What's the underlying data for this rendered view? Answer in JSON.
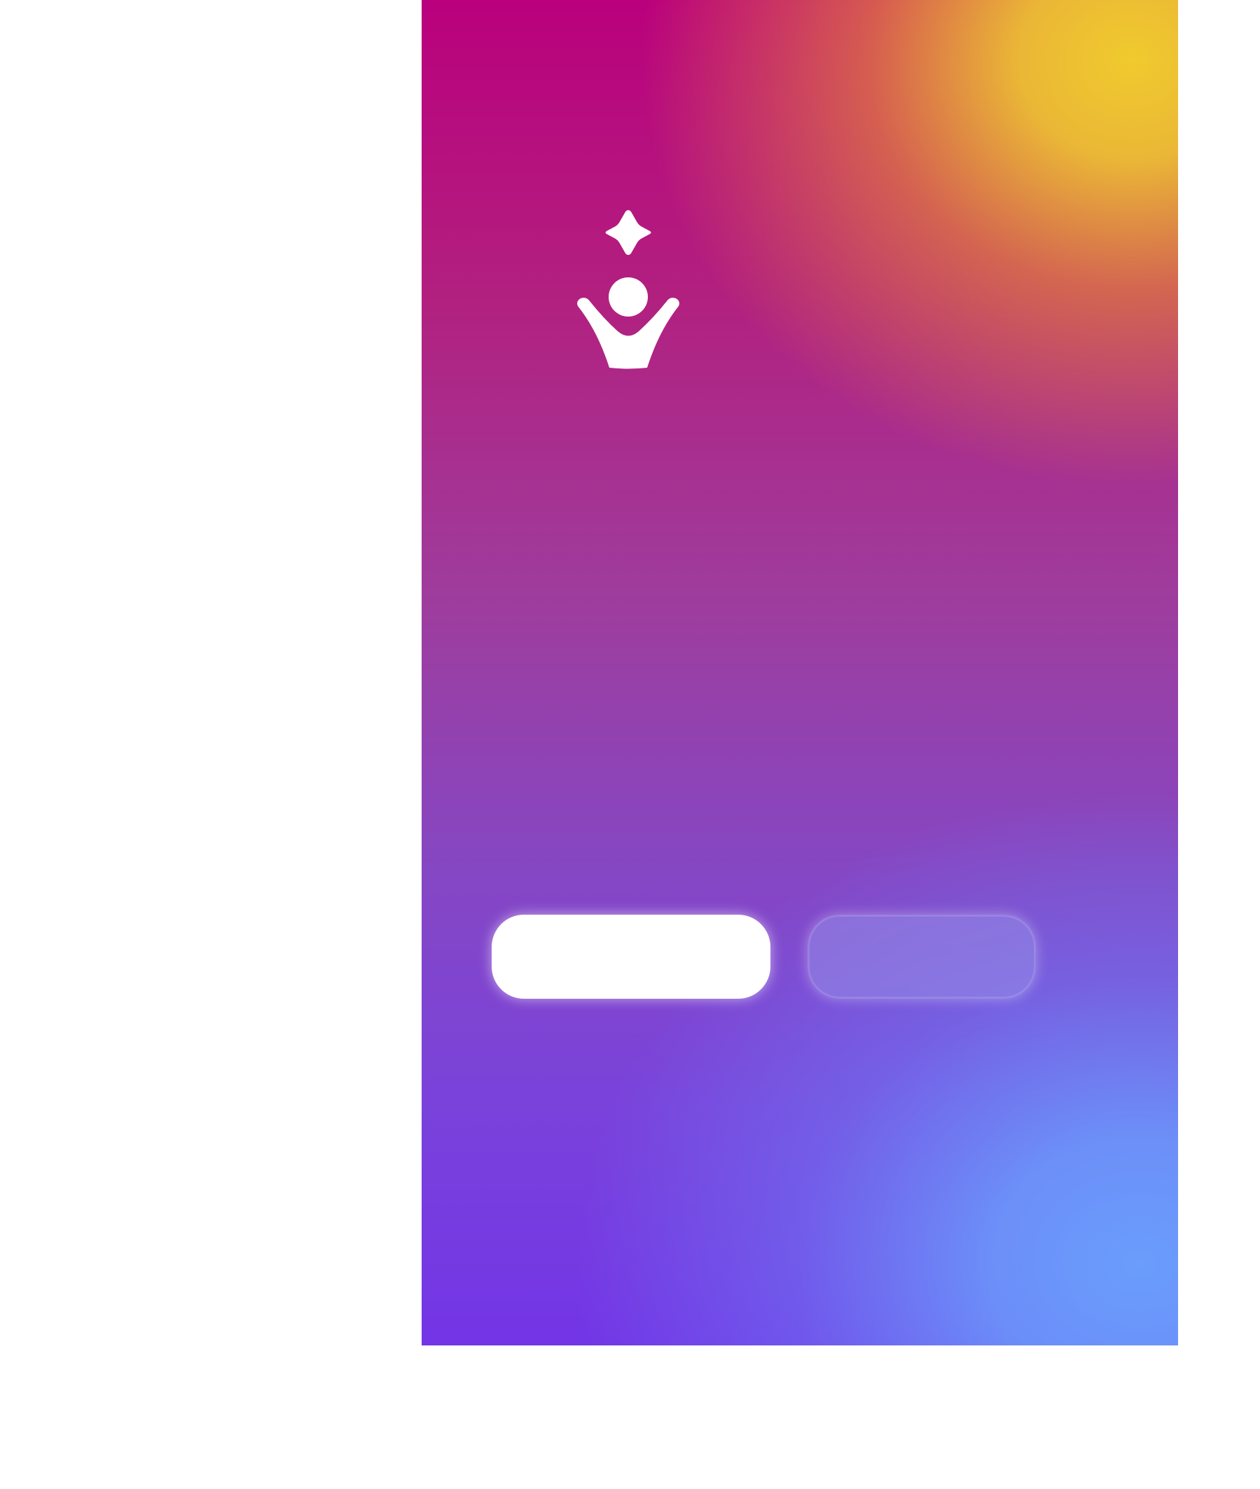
{
  "app": {
    "logo_icon": "sparkle-person-logo-icon",
    "gradient_colors": [
      "#ba007d",
      "#f0ca2e",
      "#7335e6",
      "#6a9dfc"
    ]
  },
  "actions": {
    "primary_label": "",
    "secondary_label": ""
  }
}
